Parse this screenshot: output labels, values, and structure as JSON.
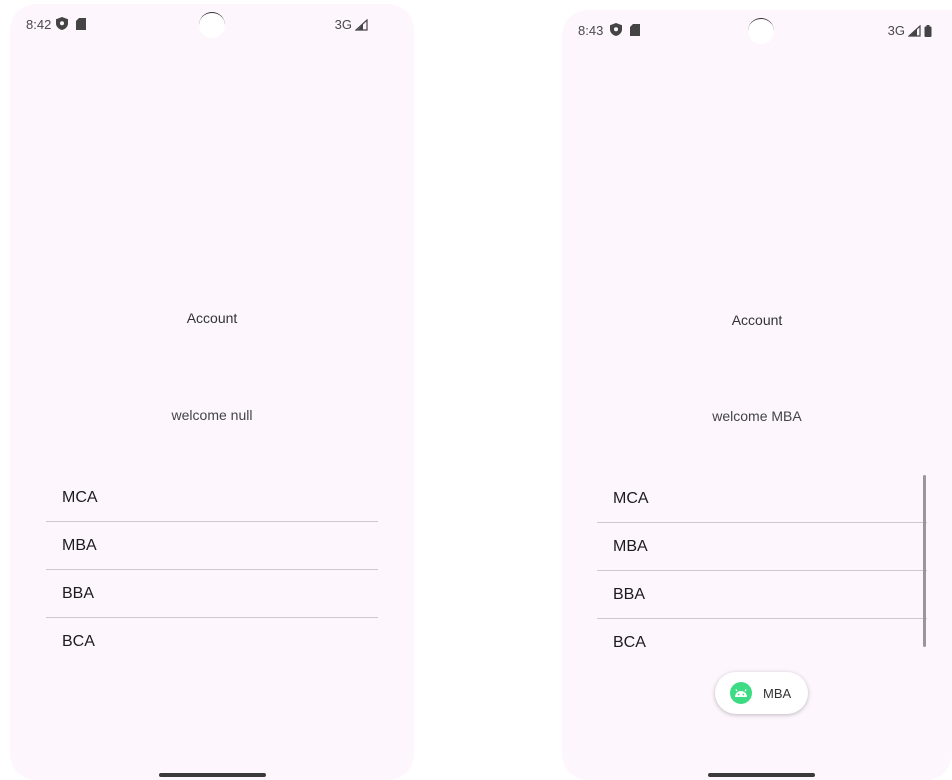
{
  "left_screen": {
    "status": {
      "time": "8:42",
      "network": "3G"
    },
    "title": "Account",
    "welcome": "welcome null",
    "list": [
      "MCA",
      "MBA",
      "BBA",
      "BCA"
    ]
  },
  "right_screen": {
    "status": {
      "time": "8:43",
      "network": "3G"
    },
    "title": "Account",
    "welcome": "welcome MBA",
    "list": [
      "MCA",
      "MBA",
      "BBA",
      "BCA"
    ],
    "toast": {
      "text": "MBA",
      "icon": "android-icon"
    }
  },
  "colors": {
    "background": "#fdf6fd",
    "divider": "#cfc8cf",
    "android_green": "#3ddc84"
  }
}
